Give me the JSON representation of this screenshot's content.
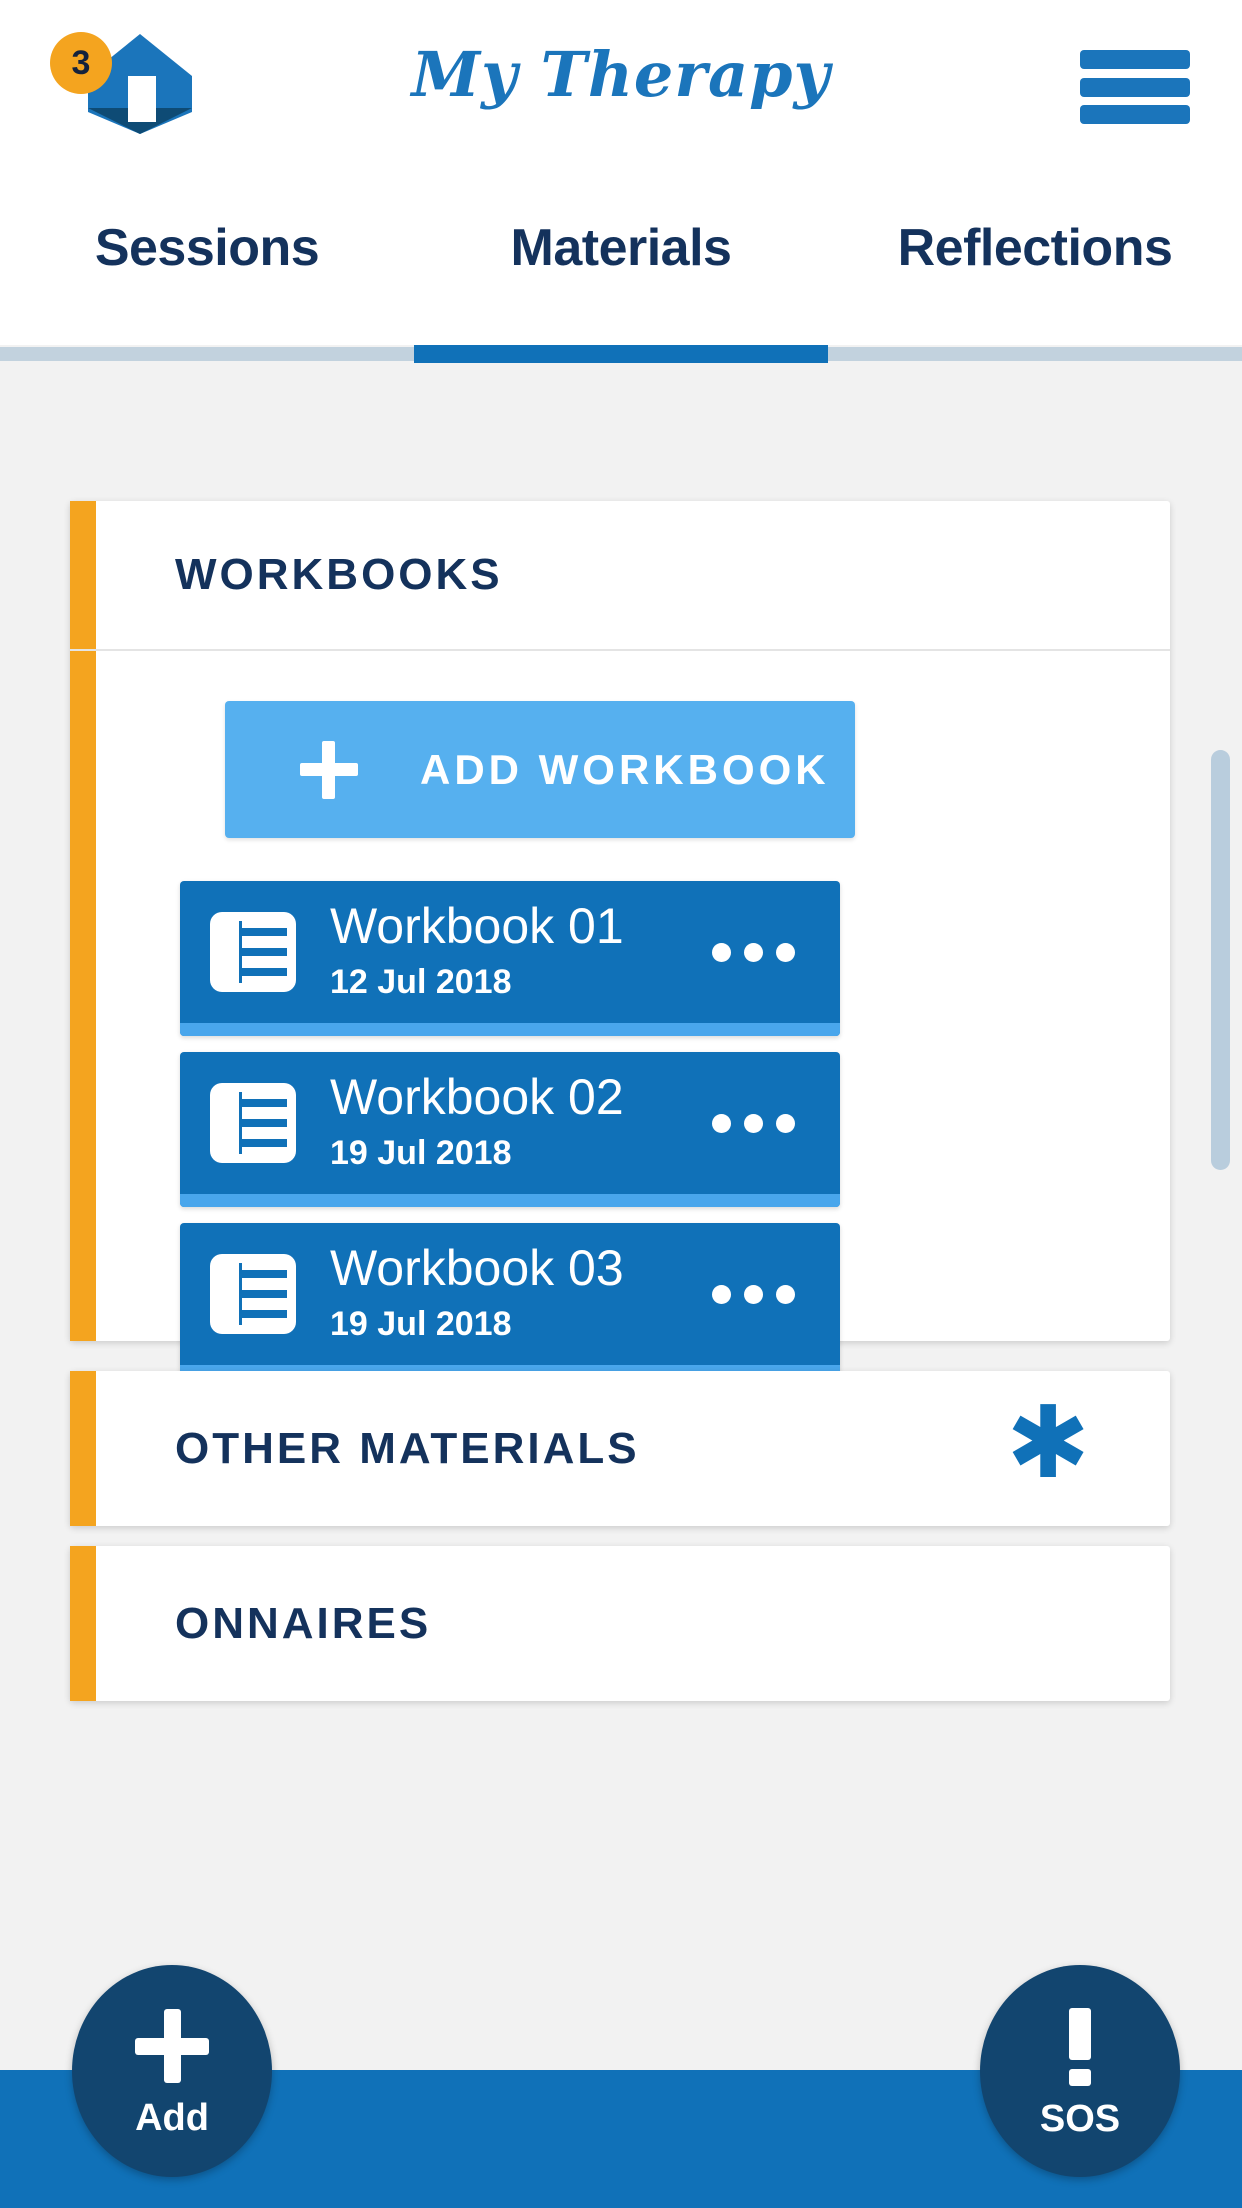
{
  "header": {
    "app_title": "My Therapy",
    "logo_icon": "house-icon",
    "badge_count": "3",
    "menu_icon": "hamburger-menu-icon"
  },
  "tabs": {
    "items": [
      {
        "label": "Sessions",
        "active": false
      },
      {
        "label": "Materials",
        "active": true
      },
      {
        "label": "Reflections",
        "active": false
      }
    ]
  },
  "workbooks": {
    "section_title": "WORKBOOKS",
    "add_button_label": "ADD WORKBOOK",
    "add_button_icon": "plus-icon",
    "items": [
      {
        "title": "Workbook 01",
        "date": "12 Jul 2018",
        "icon": "document-icon",
        "menu_icon": "more-options-icon"
      },
      {
        "title": "Workbook 02",
        "date": "19 Jul 2018",
        "icon": "document-icon",
        "menu_icon": "more-options-icon"
      },
      {
        "title": "Workbook 03",
        "date": "19 Jul 2018",
        "icon": "document-icon",
        "menu_icon": "more-options-icon"
      }
    ]
  },
  "other_materials": {
    "section_title": "OTHER MATERIALS",
    "badge_icon": "asterisk-icon",
    "badge_glyph": "✱"
  },
  "questionnaires": {
    "section_title": "ONNAIRES"
  },
  "bottom_bar": {
    "add_fab": {
      "label": "Add",
      "icon": "plus-icon"
    },
    "sos_fab": {
      "label": "SOS",
      "icon": "exclamation-icon"
    }
  },
  "colors": {
    "brand_blue": "#1071b8",
    "light_blue": "#56b0ef",
    "navy": "#14325c",
    "dark_navy": "#12456f",
    "orange": "#f4a41f",
    "page_bg": "#f2f2f2"
  }
}
